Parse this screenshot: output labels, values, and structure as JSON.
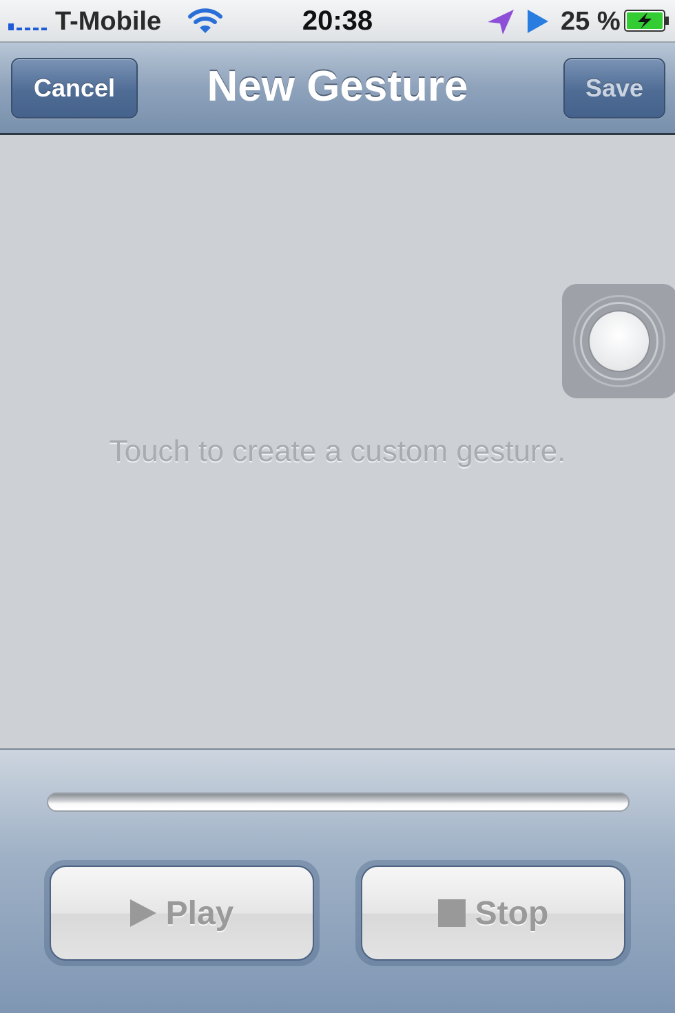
{
  "status_bar": {
    "carrier": "T-Mobile",
    "time": "20:38",
    "battery_percent": "25 %",
    "icons": [
      "signal-icon",
      "wifi-icon",
      "location-arrow-icon",
      "play-status-icon",
      "battery-charging-icon"
    ]
  },
  "nav": {
    "title": "New Gesture",
    "cancel_label": "Cancel",
    "save_label": "Save"
  },
  "canvas": {
    "hint": "Touch to create a custom gesture."
  },
  "toolbar": {
    "play_label": "Play",
    "stop_label": "Stop",
    "progress": 0
  },
  "colors": {
    "nav_accent": "#4f6c95",
    "signal": "#1f5bd6",
    "battery_fill": "#33cc33"
  }
}
